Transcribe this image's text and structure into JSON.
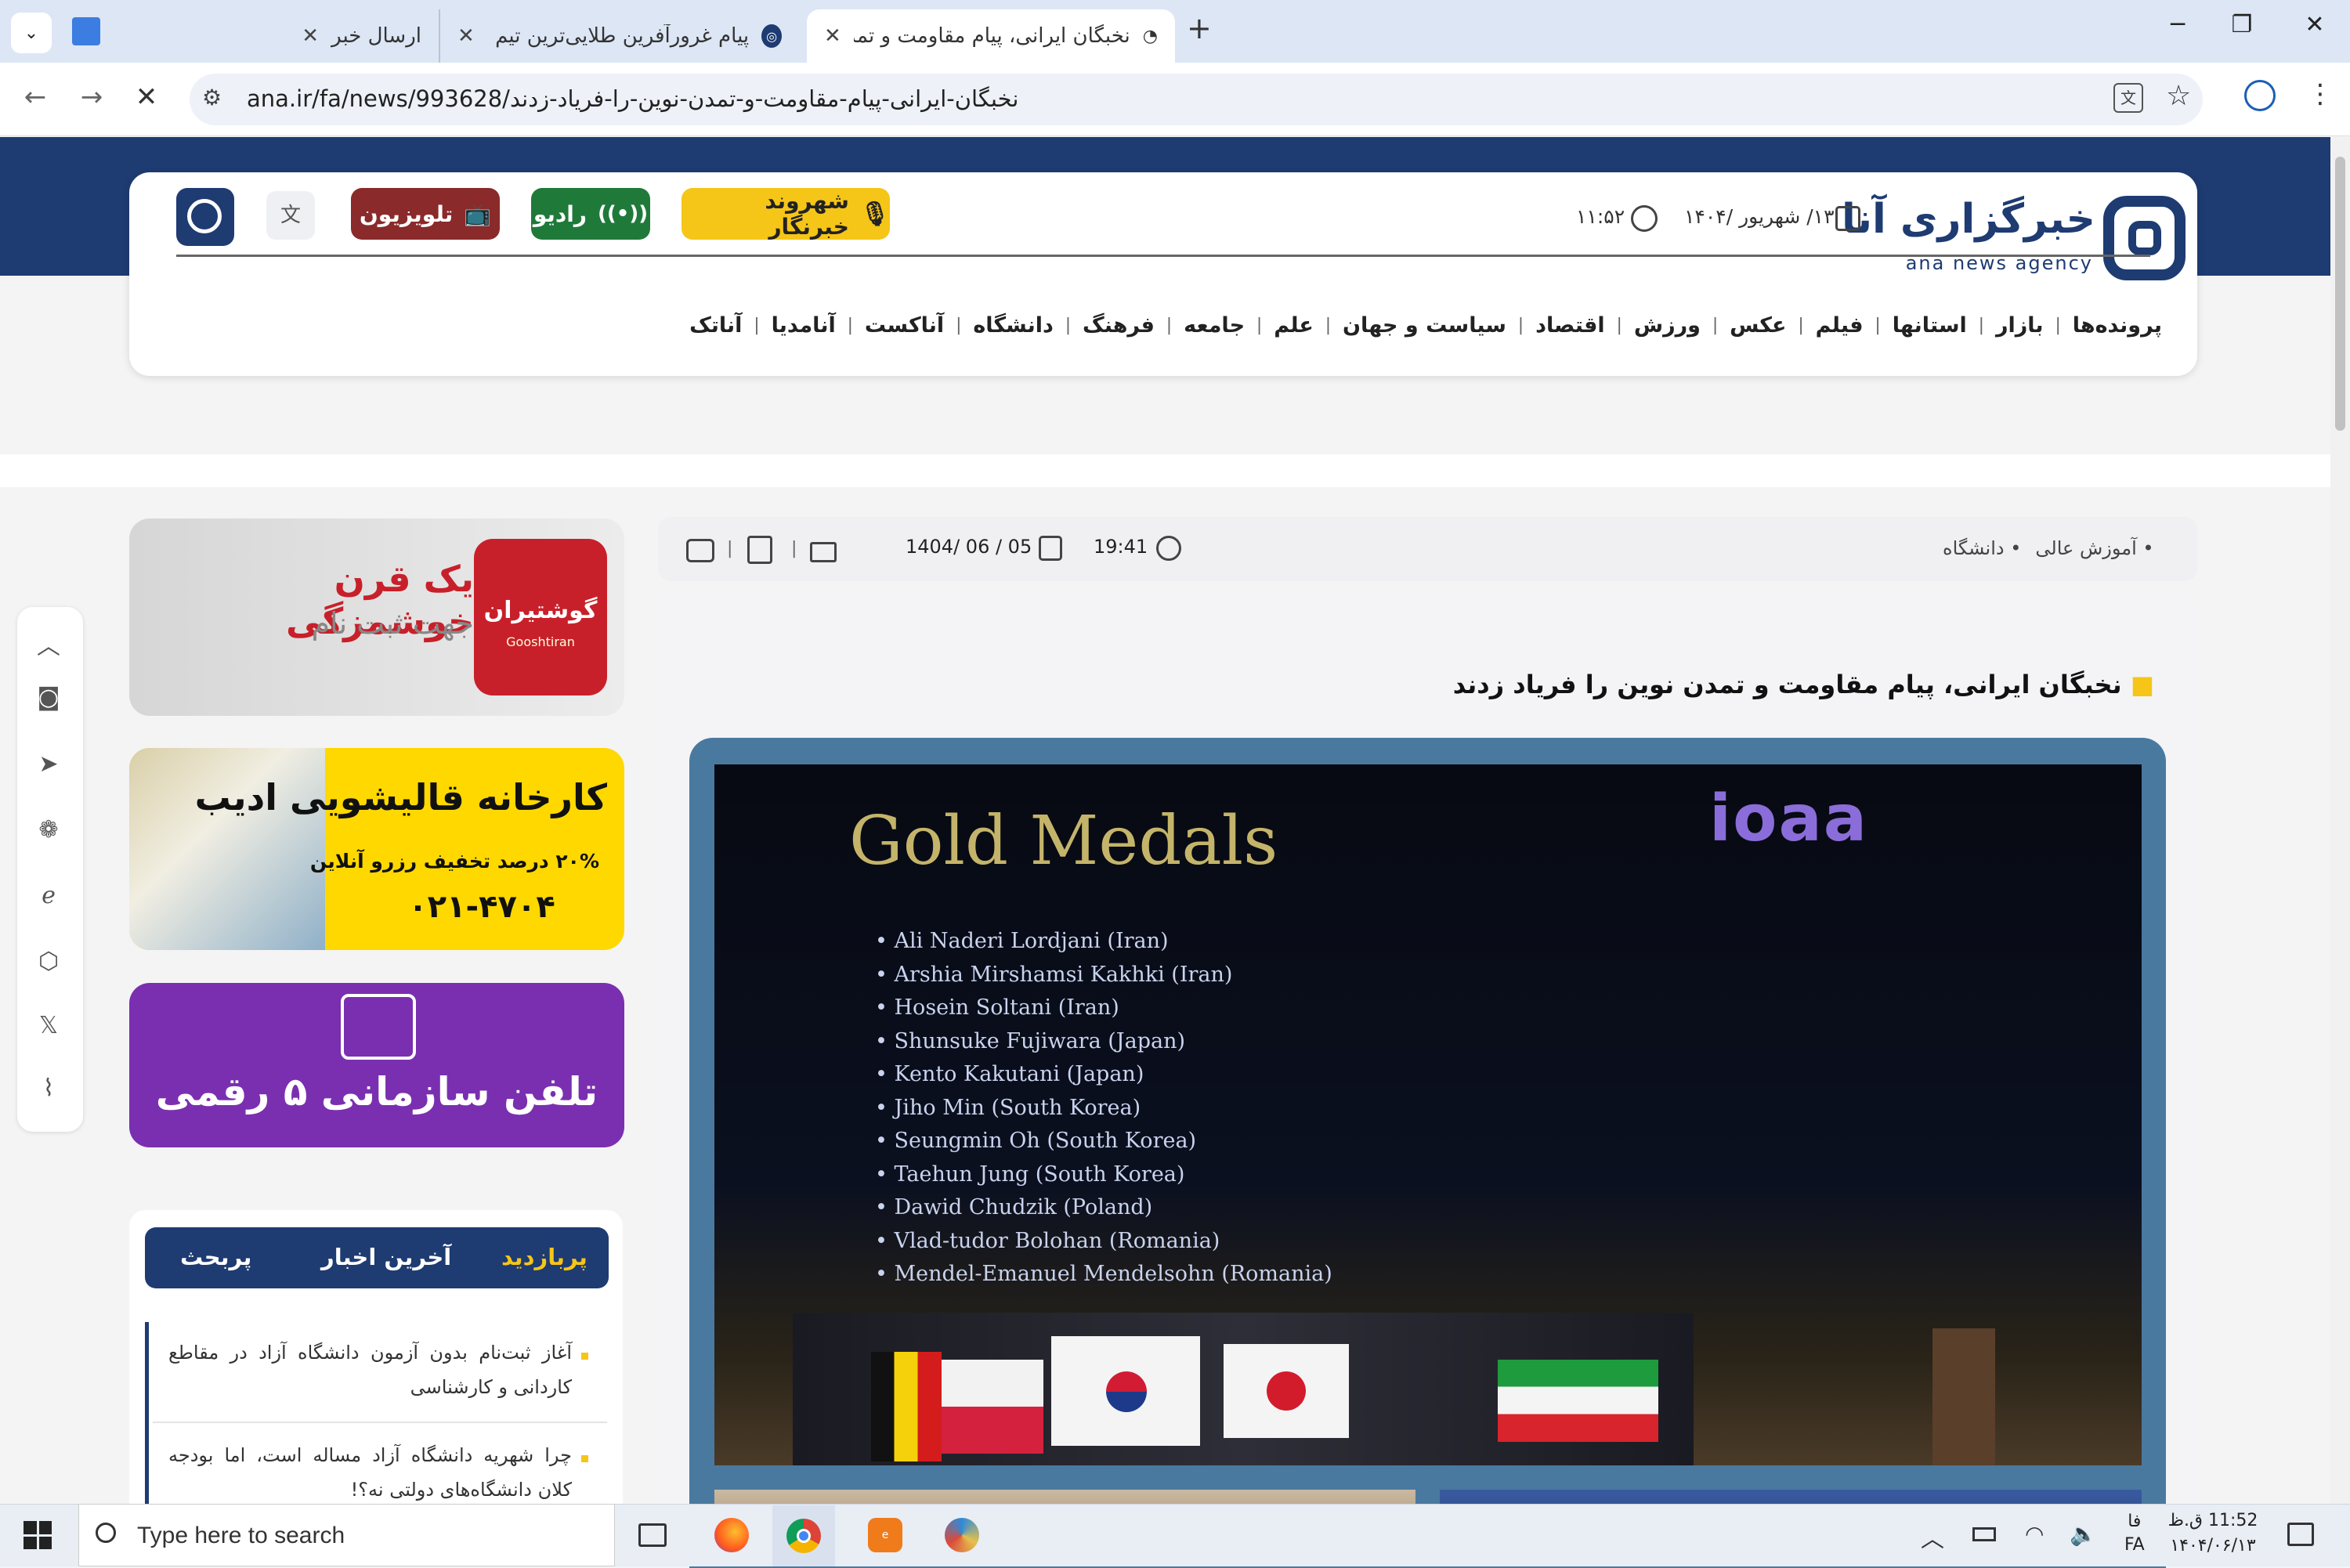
{
  "browser": {
    "tabs": [
      {
        "title": "ارسال خبر",
        "active": false
      },
      {
        "title": "پیام غرورآفرین طلایی‌ترین تیم المپ",
        "active": false
      },
      {
        "title": "نخبگان ایرانی، پیام مقاومت و تمدن",
        "active": true
      }
    ],
    "new_tab": "+",
    "url": "ana.ir/fa/news/993628/نخبگان-ایرانی-پیام-مقاومت-و-تمدن-نوین-را-فریاد-زدند",
    "window_controls": {
      "minimize": "─",
      "maximize": "❐",
      "close": "✕"
    }
  },
  "header": {
    "logo_fa": "خبرگزاری آنا",
    "logo_en": "ana news agency",
    "date": "۱۳/ شهریور /۱۴۰۴",
    "time": "۱۱:۵۲",
    "citizen_reporter": "شهروند خبرنگار",
    "radio": "رادیو",
    "tv": "تلویزیون"
  },
  "nav": [
    "آناتک",
    "آنامدیا",
    "آناکست",
    "دانشگاه",
    "فرهنگ",
    "جامعه",
    "علم",
    "سیاست و جهان",
    "اقتصاد",
    "ورزش",
    "عکس",
    "فیلم",
    "استانها",
    "بازار",
    "پرونده‌ها"
  ],
  "article": {
    "breadcrumb": [
      "دانشگاه",
      "آموزش عالی"
    ],
    "time": "19:41",
    "date": "1404/ 06 / 05",
    "title": "نخبگان ایرانی، پیام مقاومت و تمدن نوین را فریاد زدند",
    "photo": {
      "heading": "Gold Medals",
      "logo": "ioaa",
      "medalists": [
        "Ali Naderi Lordjani (Iran)",
        "Arshia Mirshamsi Kakhki (Iran)",
        "Hosein Soltani (Iran)",
        "Shunsuke Fujiwara (Japan)",
        "Kento Kakutani (Japan)",
        "Jiho Min (South Korea)",
        "Seungmin Oh (South Korea)",
        "Taehun Jung (South Korea)",
        "Dawid Chudzik (Poland)",
        "Vlad-tudor Bolohan (Romania)",
        "Mendel-Emanuel Mendelsohn (Romania)"
      ]
    }
  },
  "ads": {
    "goosht_title": "یک قرن خوشمزگی",
    "goosht_sub": "جهت ثبت نام",
    "goosht_brand": "گوشتیران",
    "goosht_brand_en": "Gooshtiran",
    "carpet_title": "کارخانه قالیشویی ادیب",
    "carpet_offer": "۲۰% درصد تخفیف رزرو آنلاین",
    "carpet_phone": "۰۲۱-۴۷۰۴",
    "phone_title": "تلفن سازمانی ۵ رقمی"
  },
  "sidebar_tabs": {
    "labels": [
      "پربازدید",
      "آخرین اخبار",
      "پربحث"
    ],
    "items": [
      "آغاز ثبت‌نام بدون آزمون دانشگاه آزاد در مقاطع کاردانی و کارشناسی",
      "چرا شهریه دانشگاه آزاد مساله است، اما بودجه کلان دانشگاه‌های دولتی نه؟!"
    ]
  },
  "taskbar": {
    "search_placeholder": "Type here to search",
    "lang": "فا",
    "lang2": "FA",
    "clock_time": "11:52 ق.ظ",
    "clock_date": "۱۴۰۴/۰۶/۱۳"
  },
  "colors": {
    "brand_navy": "#1e3b72",
    "citizen_yellow": "#f5c518",
    "radio_green": "#1f7a3a",
    "tv_red": "#8b2a2a",
    "phone_purple": "#7a2fb0"
  }
}
